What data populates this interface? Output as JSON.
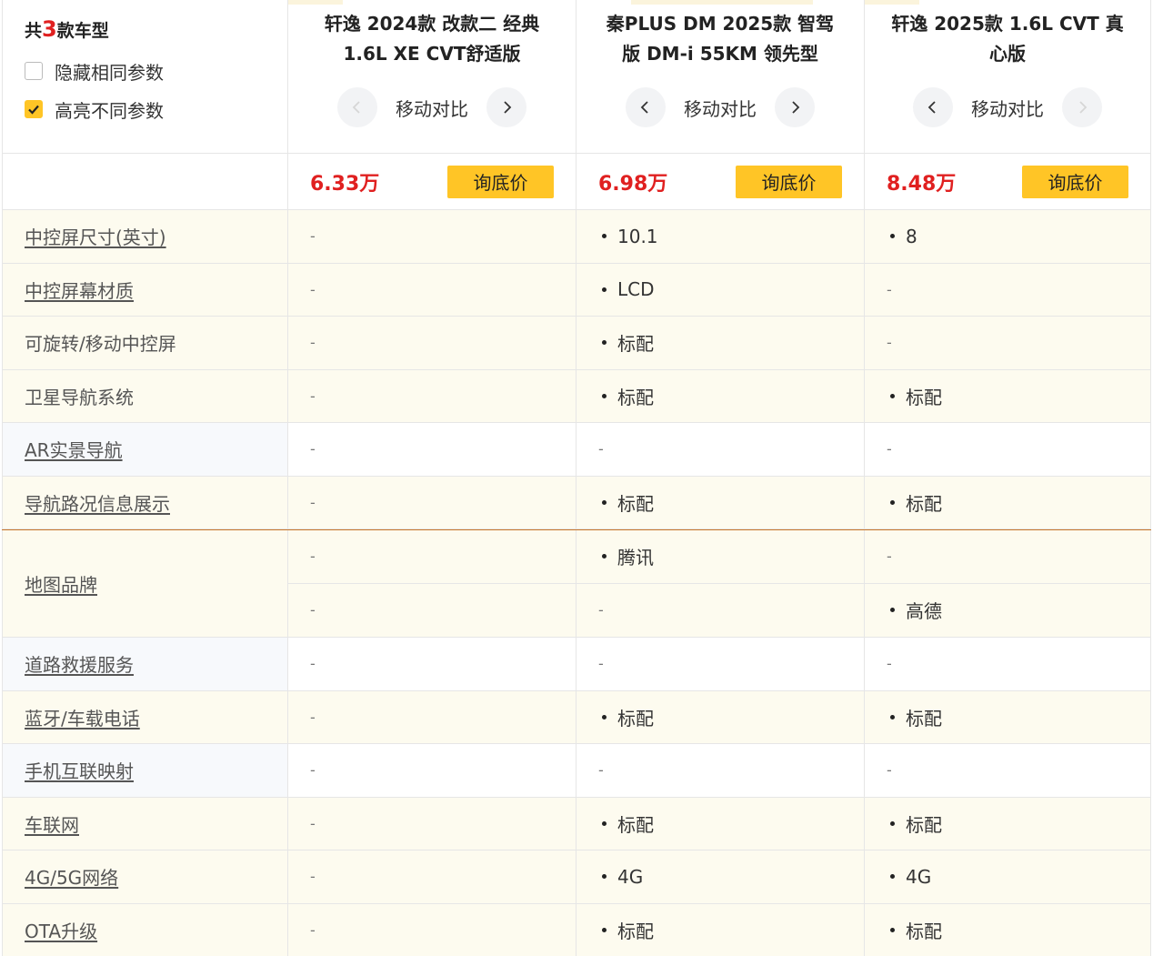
{
  "header": {
    "count_prefix": "共",
    "count_num": "3",
    "count_suffix": "款车型",
    "hide_same_label": "隐藏相同参数",
    "hide_same_checked": false,
    "highlight_diff_label": "高亮不同参数",
    "highlight_diff_checked": true,
    "move_label": "移动对比"
  },
  "cars": [
    {
      "name": "轩逸 2024款 改款二 经典 1.6L XE CVT舒适版",
      "price": "6.33万",
      "ask_label": "询底价"
    },
    {
      "name": "秦PLUS DM 2025款 智驾版 DM-i 55KM 领先型",
      "price": "6.98万",
      "ask_label": "询底价"
    },
    {
      "name": "轩逸 2025款 1.6L CVT 真心版",
      "price": "8.48万",
      "ask_label": "询底价"
    }
  ],
  "rows": [
    {
      "label": "中控屏尺寸(英寸)",
      "link": true,
      "style": "hl",
      "values": [
        "-",
        "10.1",
        "8"
      ]
    },
    {
      "label": "中控屏幕材质",
      "link": true,
      "style": "hl",
      "values": [
        "-",
        "LCD",
        "-"
      ]
    },
    {
      "label": "可旋转/移动中控屏",
      "link": false,
      "style": "hl",
      "values": [
        "-",
        "标配",
        "-"
      ]
    },
    {
      "label": "卫星导航系统",
      "link": false,
      "style": "hl",
      "values": [
        "-",
        "标配",
        "标配"
      ]
    },
    {
      "label": "AR实景导航",
      "link": true,
      "style": "wh",
      "values": [
        "-",
        "-",
        "-"
      ]
    },
    {
      "label": "导航路况信息展示",
      "link": true,
      "style": "hl",
      "values": [
        "-",
        "标配",
        "标配"
      ]
    }
  ],
  "map_row": {
    "label": "地图品牌",
    "sub": [
      [
        "-",
        "腾讯",
        "-"
      ],
      [
        "-",
        "-",
        "高德"
      ]
    ]
  },
  "rows2": [
    {
      "label": "道路救援服务",
      "link": true,
      "style": "wh",
      "values": [
        "-",
        "-",
        "-"
      ]
    },
    {
      "label": "蓝牙/车载电话",
      "link": true,
      "style": "hl",
      "values": [
        "-",
        "标配",
        "标配"
      ]
    },
    {
      "label": "手机互联映射",
      "link": true,
      "style": "wh",
      "values": [
        "-",
        "-",
        "-"
      ]
    },
    {
      "label": "车联网",
      "link": true,
      "style": "hl",
      "values": [
        "-",
        "标配",
        "标配"
      ]
    },
    {
      "label": "4G/5G网络",
      "link": true,
      "style": "hl",
      "values": [
        "-",
        "4G",
        "4G"
      ]
    },
    {
      "label": "OTA升级",
      "link": true,
      "style": "hl",
      "values": [
        "-",
        "标配",
        "标配"
      ]
    }
  ],
  "colors": {
    "accent": "#ffc526",
    "price": "#e02020",
    "highlight_bg": "#fdfbef"
  },
  "icons": {
    "prev": "chevron-left-icon",
    "next": "chevron-right-icon",
    "check": "check-icon"
  }
}
